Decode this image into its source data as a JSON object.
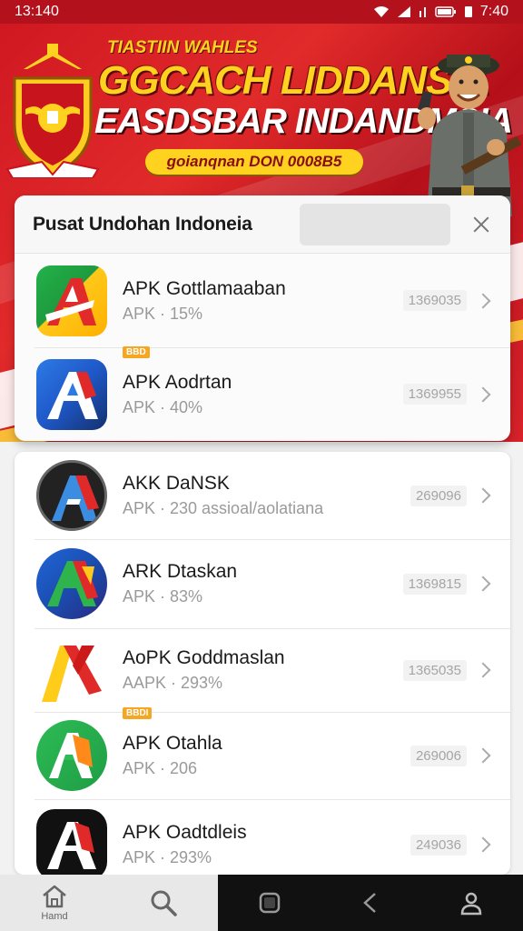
{
  "status_bar": {
    "time": "13:140",
    "right_time": "7:40"
  },
  "banner": {
    "supertitle": "TIASTIIN WAHLES",
    "title": "GGCACH LIDDANSIA",
    "subtitle": "EASDSBAR INDANDMSIA",
    "pill": "goianqnan DON 0008B5"
  },
  "dialog": {
    "title": "Pusat Undohan Indoneia",
    "search_placeholder": ""
  },
  "featured_apps": [
    {
      "name": "APK Gottlamaaban",
      "meta": "APK · 15%",
      "size": "1369035",
      "badge": ""
    },
    {
      "name": "APK Aodrtan",
      "meta": "APK · 40%",
      "size": "1369955",
      "badge": "BBD"
    }
  ],
  "apps": [
    {
      "name": "AKK DaNSK",
      "meta": "APK · 230 assioal/aolatiana",
      "size": "269096"
    },
    {
      "name": "ARK Dtaskan",
      "meta": "APK · 83%",
      "size": "1369815"
    },
    {
      "name": "AoPK Goddmaslan",
      "meta": "AAPK · 293%",
      "size": "1365035"
    },
    {
      "name": "APK Otahla",
      "meta": "APK · 206",
      "size": "269006",
      "badge": "BBDI"
    },
    {
      "name": "APK  Oadtdleis",
      "meta": "APK · 293%",
      "size": "249036"
    }
  ],
  "bottom_nav": {
    "home_label": "Hamd"
  },
  "colors": {
    "banner_red": "#d01822",
    "gold": "#ffd21f"
  }
}
